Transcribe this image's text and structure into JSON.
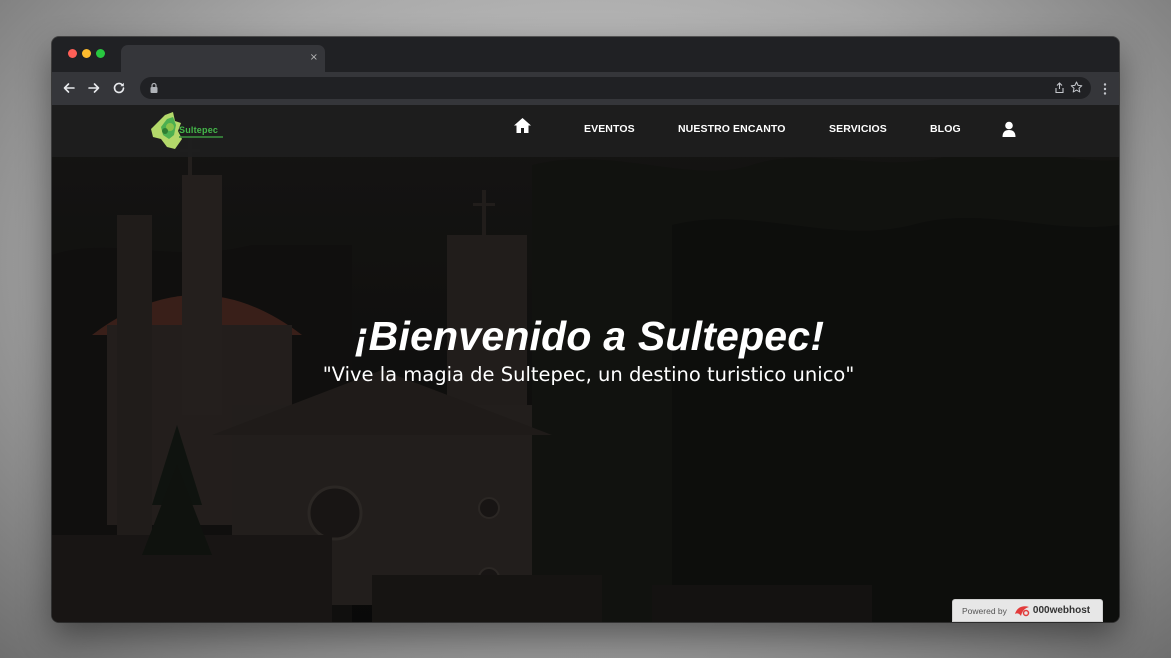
{
  "browser": {
    "tab_close": "×"
  },
  "site": {
    "logo_text": "Sultepec",
    "nav": {
      "eventos": "EVENTOS",
      "nuestro_encanto": "NUESTRO ENCANTO",
      "servicios": "SERVICIOS",
      "blog": "BLOG"
    },
    "hero": {
      "title": "¡Bienvenido a Sultepec!",
      "subtitle": "\"Vive la magia de Sultepec, un destino turistico unico\""
    },
    "badge": {
      "label": "Powered by",
      "brand": "000webhost"
    }
  },
  "icons": {
    "home": "home-icon",
    "user": "user-icon",
    "lock": "lock-icon",
    "share": "share-icon",
    "star": "star-icon",
    "menu": "kebab-menu-icon"
  },
  "colors": {
    "logo_green": "#44b84a",
    "nav_bg": "#1e1e1e",
    "badge_bg": "#e7e7e7",
    "badge_accent": "#e23b3b"
  }
}
